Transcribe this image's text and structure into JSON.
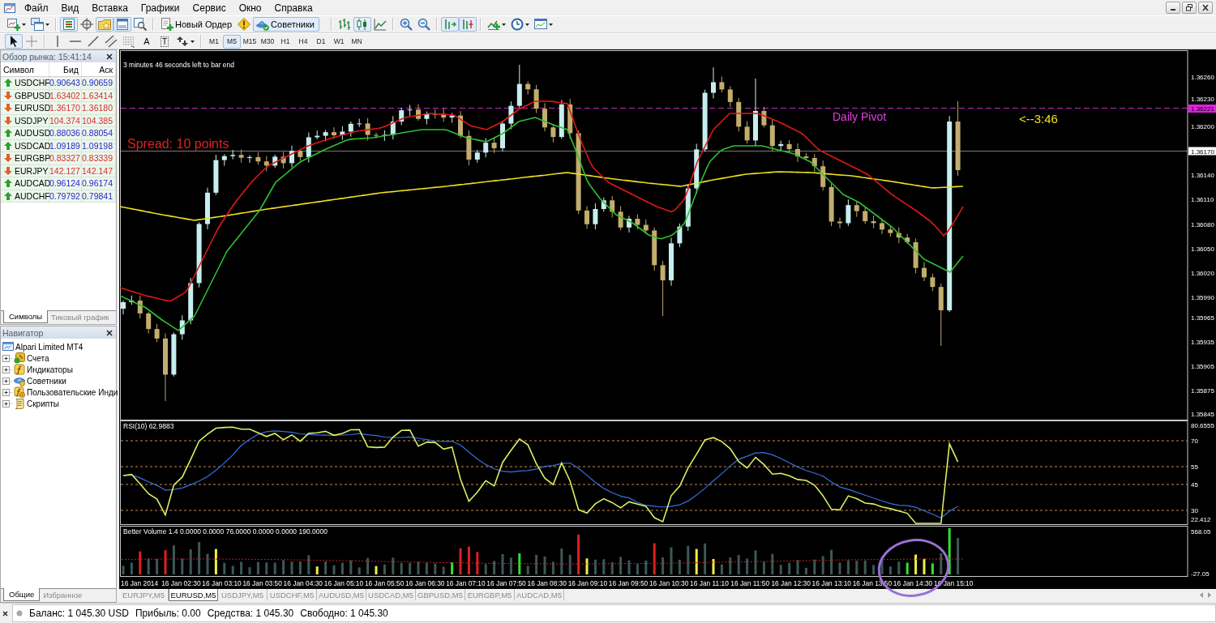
{
  "menu": [
    "Файл",
    "Вид",
    "Вставка",
    "Графики",
    "Сервис",
    "Окно",
    "Справка"
  ],
  "toolbar_1": {
    "groups": [
      {
        "items": [
          {
            "kind": "new-chart",
            "on": false
          },
          {
            "kind": "profiles",
            "on": false
          }
        ]
      },
      {
        "items": [
          {
            "kind": "market-watch",
            "on": true
          },
          {
            "kind": "data-window",
            "on": false
          },
          {
            "kind": "navigator",
            "on": true
          },
          {
            "kind": "terminal",
            "on": true
          },
          {
            "kind": "tester",
            "on": false
          }
        ]
      },
      {
        "items": [
          {
            "kind": "new-order",
            "label": "Новый Ордер",
            "on": false
          },
          {
            "kind": "alert",
            "on": false
          },
          {
            "kind": "experts",
            "label": "Советники",
            "on": true
          }
        ]
      },
      {
        "items": [
          {
            "kind": "bar-chart",
            "on": false
          },
          {
            "kind": "candles",
            "on": true
          },
          {
            "kind": "line-chart",
            "on": false
          }
        ]
      },
      {
        "items": [
          {
            "kind": "zoom-in",
            "on": false
          },
          {
            "kind": "zoom-out",
            "on": false
          }
        ]
      },
      {
        "items": [
          {
            "kind": "chart-shift",
            "on": true
          },
          {
            "kind": "auto-scroll",
            "on": true
          }
        ]
      },
      {
        "items": [
          {
            "kind": "indicators",
            "on": false
          },
          {
            "kind": "periods",
            "on": false
          },
          {
            "kind": "templates",
            "on": false
          }
        ]
      }
    ]
  },
  "toolbar_2": {
    "groups": [
      {
        "items": [
          {
            "kind": "cursor",
            "on": true
          },
          {
            "kind": "crosshair",
            "on": false
          }
        ]
      },
      {
        "items": [
          {
            "kind": "vertical-line",
            "on": false
          },
          {
            "kind": "horizontal-line",
            "on": false
          },
          {
            "kind": "trend-line",
            "on": false
          },
          {
            "kind": "channel",
            "on": false
          },
          {
            "kind": "fibonacci",
            "on": false
          },
          {
            "kind": "text",
            "label": "A",
            "on": false
          },
          {
            "kind": "text-label",
            "label": "T",
            "on": false
          },
          {
            "kind": "arrows",
            "on": false
          }
        ]
      },
      {
        "items": [
          {
            "kind": "period",
            "label": "M1",
            "on": false
          },
          {
            "kind": "period",
            "label": "M5",
            "on": true
          },
          {
            "kind": "period",
            "label": "M15",
            "on": false
          },
          {
            "kind": "period",
            "label": "M30",
            "on": false
          },
          {
            "kind": "period",
            "label": "H1",
            "on": false
          },
          {
            "kind": "period",
            "label": "H4",
            "on": false
          },
          {
            "kind": "period",
            "label": "D1",
            "on": false
          },
          {
            "kind": "period",
            "label": "W1",
            "on": false
          },
          {
            "kind": "period",
            "label": "MN",
            "on": false
          }
        ]
      }
    ]
  },
  "market_watch": {
    "title": "Обзор рынка: 15:41:14",
    "columns": [
      "Символ",
      "Бид",
      "Аск"
    ],
    "rows": [
      {
        "symbol": "USDCHF",
        "bid": "0.90643",
        "ask": "0.90659",
        "kind": "up"
      },
      {
        "symbol": "GBPUSD",
        "bid": "1.63402",
        "ask": "1.63414",
        "kind": "down"
      },
      {
        "symbol": "EURUSD",
        "bid": "1.36170",
        "ask": "1.36180",
        "kind": "down"
      },
      {
        "symbol": "USDJPY",
        "bid": "104.374",
        "ask": "104.385",
        "kind": "down"
      },
      {
        "symbol": "AUDUSD",
        "bid": "0.88036",
        "ask": "0.88054",
        "kind": "up"
      },
      {
        "symbol": "USDCAD",
        "bid": "1.09189",
        "ask": "1.09198",
        "kind": "up"
      },
      {
        "symbol": "EURGBP",
        "bid": "0.83327",
        "ask": "0.83339",
        "kind": "down"
      },
      {
        "symbol": "EURJPY",
        "bid": "142.127",
        "ask": "142.147",
        "kind": "down"
      },
      {
        "symbol": "AUDCAD",
        "bid": "0.96124",
        "ask": "0.96174",
        "kind": "up"
      },
      {
        "symbol": "AUDCHF",
        "bid": "0.79792",
        "ask": "0.79841",
        "kind": "up"
      }
    ],
    "tabs": [
      {
        "label": "Символы",
        "selected": true
      },
      {
        "label": "Тиковый график",
        "selected": false
      }
    ]
  },
  "navigator": {
    "title": "Навигатор",
    "tree": [
      {
        "label": "Alpari Limited MT4",
        "kind": "server",
        "children": [
          {
            "label": "Счета",
            "kind": "accounts",
            "expanded": false
          },
          {
            "label": "Индикаторы",
            "kind": "indicators",
            "expanded": false
          },
          {
            "label": "Советники",
            "kind": "experts",
            "expanded": false
          },
          {
            "label": "Пользовательские Инди",
            "kind": "custom-indicators",
            "expanded": false
          },
          {
            "label": "Скрипты",
            "kind": "scripts",
            "expanded": false
          }
        ]
      }
    ],
    "tabs": [
      {
        "label": "Общие",
        "selected": true
      },
      {
        "label": "Избранное",
        "selected": false
      }
    ]
  },
  "chart": {
    "bar_timer": "3 minutes 46 seconds left to bar end",
    "spread": "Spread: 10 points",
    "pivot_label": "Daily Pivot",
    "countdown": "<--3:46",
    "price_axis": [
      "1.36260",
      "1.36230",
      "1.36200",
      "1.36140",
      "1.36110",
      "1.36080",
      "1.36050",
      "1.36020",
      "1.35990",
      "1.35965",
      "1.35935",
      "1.35905",
      "1.35875",
      "1.35845"
    ],
    "pivot_price": "1.36221",
    "current_price": "1.36170",
    "rsi": {
      "title": "RSI(10) 62.9883",
      "axis": [
        "80.6555",
        "70",
        "55",
        "45",
        "30",
        "22.412"
      ]
    },
    "volume": {
      "title": "Better Volume 1.4 0.0000 0.0000 76.0000 0.0000 0.0000 190.0000",
      "axis": [
        "568.05",
        "-27.05"
      ]
    },
    "time_axis": [
      "16 Jan 2014",
      "16 Jan 02:30",
      "16 Jan 03:10",
      "16 Jan 03:50",
      "16 Jan 04:30",
      "16 Jan 05:10",
      "16 Jan 05:50",
      "16 Jan 06:30",
      "16 Jan 07:10",
      "16 Jan 07:50",
      "16 Jan 08:30",
      "16 Jan 09:10",
      "16 Jan 09:50",
      "16 Jan 10:30",
      "16 Jan 11:10",
      "16 Jan 11:50",
      "16 Jan 12:30",
      "16 Jan 13:10",
      "16 Jan 13:50",
      "16 Jan 14:30",
      "16 Jan 15:10"
    ]
  },
  "chart_tabs": [
    {
      "label": "EURJPY,M5",
      "selected": false
    },
    {
      "label": "EURUSD,M5",
      "selected": true
    },
    {
      "label": "USDJPY,M5",
      "selected": false
    },
    {
      "label": "USDCHF,M5",
      "selected": false
    },
    {
      "label": "AUDUSD,M5",
      "selected": false
    },
    {
      "label": "USDCAD,M5",
      "selected": false
    },
    {
      "label": "GBPUSD,M5",
      "selected": false
    },
    {
      "label": "EURGBP,M5",
      "selected": false
    },
    {
      "label": "AUDCAD,M5",
      "selected": false
    }
  ],
  "status_bar": [
    "Баланс: 1 045.30 USD",
    "Прибыль: 0.00",
    "Средства: 1 045.30",
    "Свободно: 1 045.30"
  ]
}
